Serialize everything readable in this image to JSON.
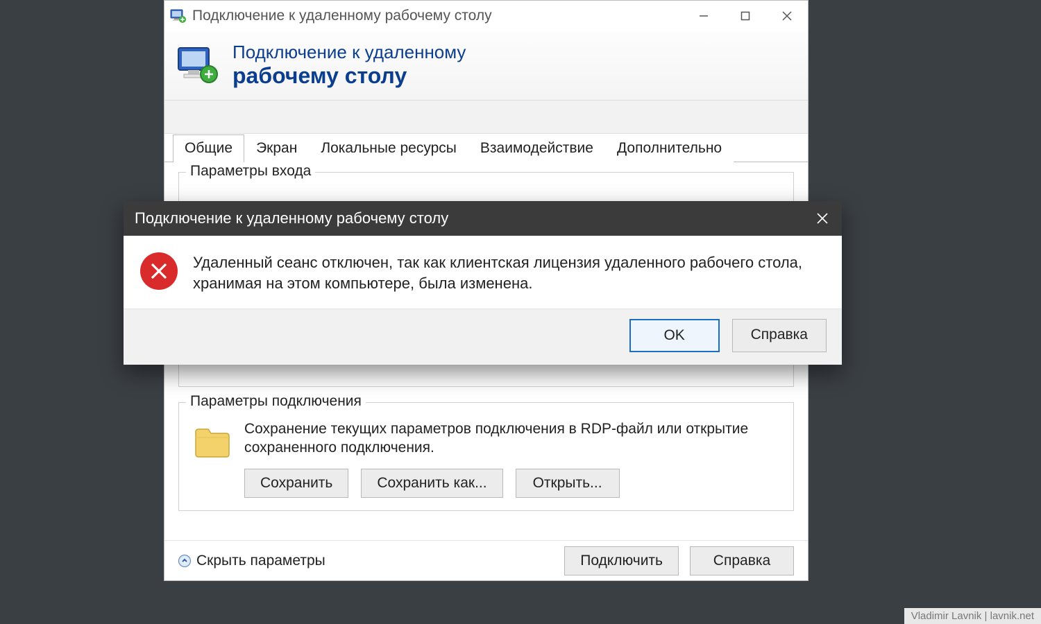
{
  "window": {
    "title": "Подключение к удаленному рабочему столу",
    "banner_line1": "Подключение к удаленному",
    "banner_line2": "рабочему столу"
  },
  "tabs": {
    "general": "Общие",
    "screen": "Экран",
    "local_resources": "Локальные ресурсы",
    "experience": "Взаимодействие",
    "advanced": "Дополнительно"
  },
  "group_login": {
    "legend": "Параметры входа"
  },
  "group_conn": {
    "legend": "Параметры подключения",
    "desc": "Сохранение текущих параметров подключения в RDP-файл или открытие сохраненного подключения.",
    "save": "Сохранить",
    "save_as": "Сохранить как...",
    "open": "Открыть..."
  },
  "bottom": {
    "toggle": "Скрыть параметры",
    "connect": "Подключить",
    "help": "Справка"
  },
  "dialog": {
    "title": "Подключение к удаленному рабочему столу",
    "message": "Удаленный сеанс отключен, так как клиентская лицензия удаленного рабочего стола, хранимая на этом компьютере, была изменена.",
    "ok": "OK",
    "help": "Справка"
  },
  "watermark": "Vladimir Lavnik | lavnik.net"
}
